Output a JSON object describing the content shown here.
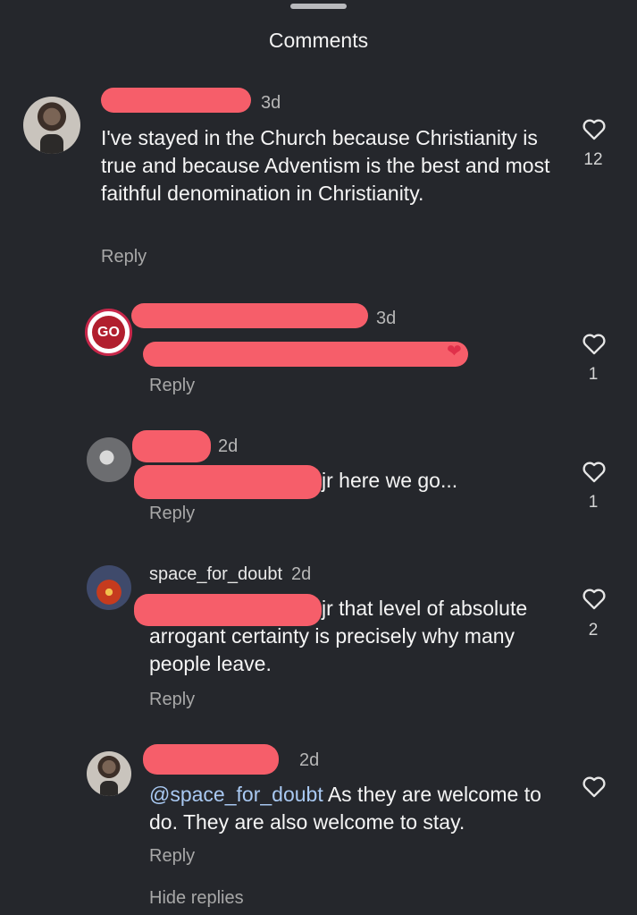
{
  "header": {
    "title": "Comments"
  },
  "comments": [
    {
      "time": "3d",
      "text": "I've stayed in the Church because Christianity is true and because Adventism is the best and most faithful denomination in Christianity.",
      "reply": "Reply",
      "likes": "12"
    },
    {
      "time": "3d",
      "reply": "Reply",
      "likes": "1"
    },
    {
      "time": "2d",
      "text_tail": "jr here we go...",
      "reply": "Reply",
      "likes": "1"
    },
    {
      "username": "space_for_doubt",
      "time": "2d",
      "text_tail_1": "jr that level of absolute",
      "text_rest": "arrogant certainty is precisely why many people leave.",
      "reply": "Reply",
      "likes": "2"
    },
    {
      "time": "2d",
      "mention": "@space_for_doubt",
      "text": " As they are welcome to do. They are also welcome to stay.",
      "reply": "Reply"
    }
  ],
  "footer": {
    "hide_replies": "Hide replies"
  },
  "icons": {
    "like": "heart-outline-icon"
  },
  "colors": {
    "background": "#25272c",
    "mention": "#a9c9f2",
    "redaction": "#f65e6a"
  }
}
